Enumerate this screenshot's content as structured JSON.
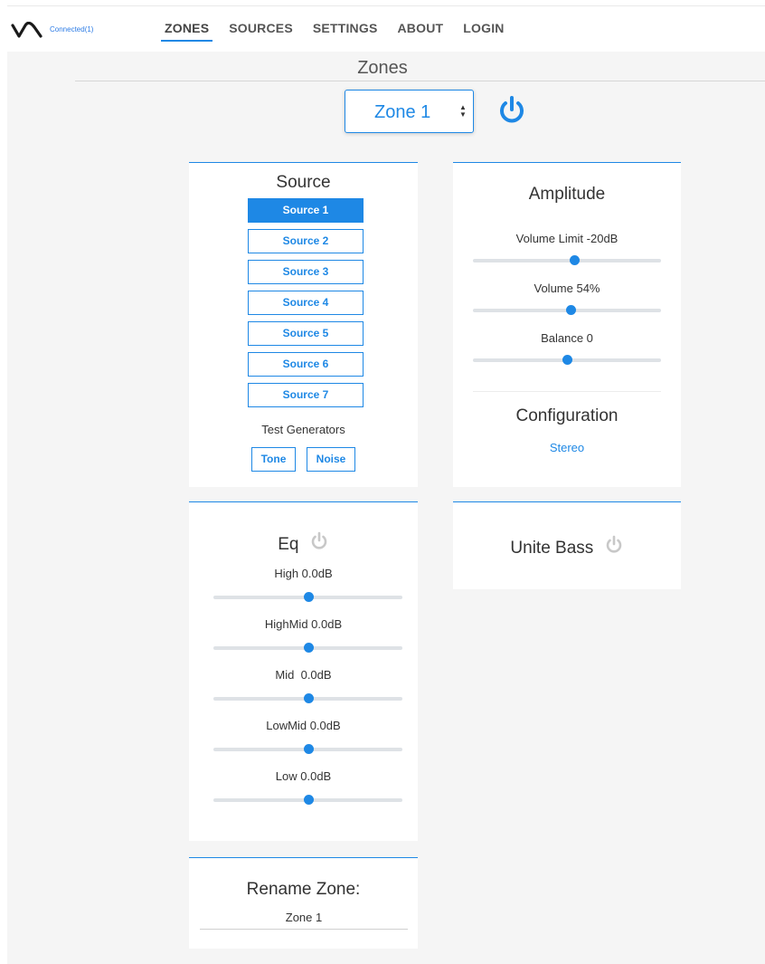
{
  "app": {
    "connection_status": "Connected(1)",
    "accent_color": "#1e88e5"
  },
  "nav": {
    "items": [
      "ZONES",
      "SOURCES",
      "SETTINGS",
      "ABOUT",
      "LOGIN"
    ],
    "active": "ZONES"
  },
  "page": {
    "title": "Zones"
  },
  "zone_select": {
    "value": "Zone 1",
    "power_icon": "power-icon"
  },
  "source_card": {
    "title": "Source",
    "sources": [
      "Source 1",
      "Source 2",
      "Source 3",
      "Source 4",
      "Source 5",
      "Source 6",
      "Source 7"
    ],
    "selected": "Source 1",
    "generators_label": "Test Generators",
    "generators": [
      "Tone",
      "Noise"
    ]
  },
  "amplitude_card": {
    "title": "Amplitude",
    "sliders": [
      {
        "label": "Volume Limit -20dB",
        "value": 0.54
      },
      {
        "label": "Volume 54%",
        "value": 0.52
      },
      {
        "label": "Balance 0",
        "value": 0.5
      }
    ],
    "config_title": "Configuration",
    "config_value": "Stereo"
  },
  "eq_card": {
    "title": "Eq",
    "bands": [
      {
        "label": "High 0.0dB",
        "value": 0.5
      },
      {
        "label": "HighMid 0.0dB",
        "value": 0.5
      },
      {
        "label": "Mid  0.0dB",
        "value": 0.5
      },
      {
        "label": "LowMid 0.0dB",
        "value": 0.5
      },
      {
        "label": "Low 0.0dB",
        "value": 0.5
      }
    ]
  },
  "unite_bass_card": {
    "title": "Unite Bass"
  },
  "rename_card": {
    "title": "Rename Zone:",
    "value": "Zone 1"
  }
}
